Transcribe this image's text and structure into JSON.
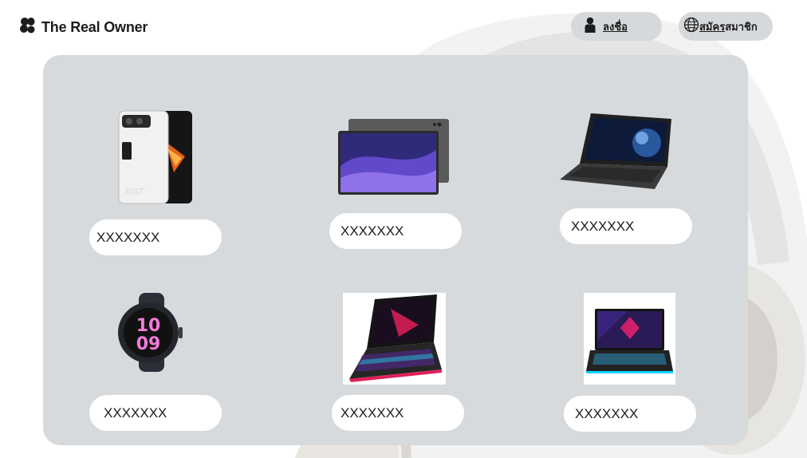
{
  "header": {
    "brand_name": "The Real Owner",
    "brand_icon": "leaf-cluster-icon",
    "login": {
      "label": "ลงชื่อ",
      "icon": "user-icon"
    },
    "register": {
      "label_part1": "สมัคร",
      "label_part2": "สมาชิก",
      "icon": "globe-icon"
    }
  },
  "products": [
    {
      "name": "XXXXXXX",
      "image": "phone-image"
    },
    {
      "name": "XXXXXXX",
      "image": "tablet-image"
    },
    {
      "name": "XXXXXXX",
      "image": "laptop-image"
    },
    {
      "name": "XXXXXXX",
      "image": "smartwatch-image"
    },
    {
      "name": "XXXXXXX",
      "image": "gaming-laptop-image"
    },
    {
      "name": "XXXXXXX",
      "image": "gaming-laptop-front-image"
    }
  ],
  "colors": {
    "panel": "#d7dadd",
    "pill": "#d6d9dc",
    "card": "#ffffff",
    "text": "#1c1c1c"
  }
}
